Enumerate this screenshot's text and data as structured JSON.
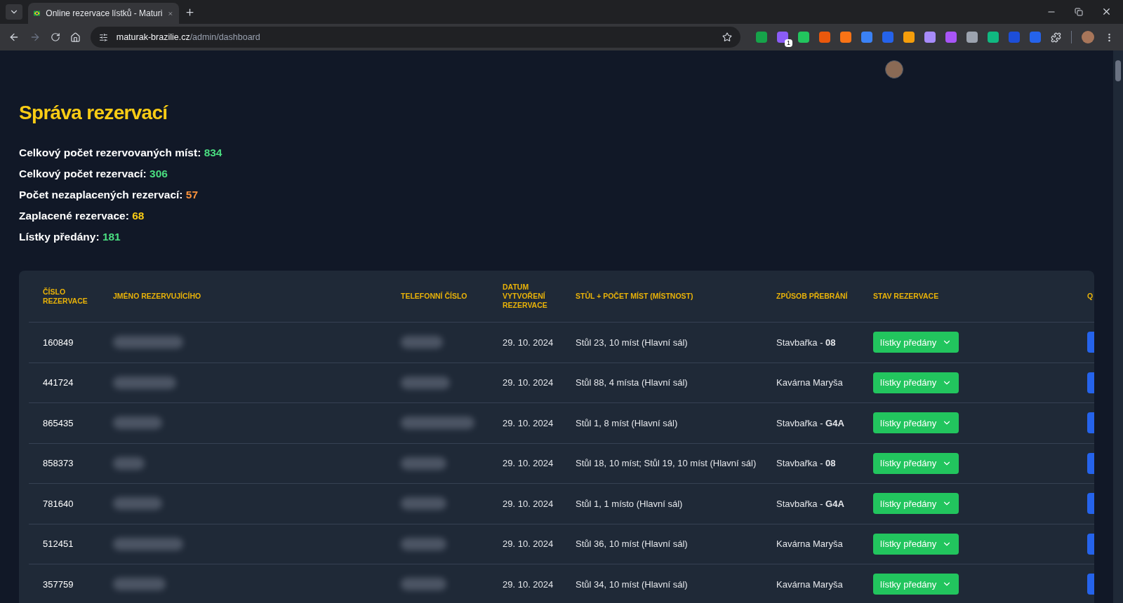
{
  "browser": {
    "tab_title": "Online rezervace lístků - Maturi",
    "url_host": "maturak-brazilie.cz",
    "url_path": "/admin/dashboard",
    "extension_badge": "1"
  },
  "page": {
    "title": "Správa rezervací",
    "stats": [
      {
        "label": "Celkový počet rezervovaných míst:",
        "value": "834",
        "color": "#4ade80"
      },
      {
        "label": "Celkový počet rezervací:",
        "value": "306",
        "color": "#4ade80"
      },
      {
        "label": "Počet nezaplacených rezervací:",
        "value": "57",
        "color": "#fb923c"
      },
      {
        "label": "Zaplacené rezervace:",
        "value": "68",
        "color": "#facc15"
      },
      {
        "label": "Lístky předány:",
        "value": "181",
        "color": "#4ade80"
      }
    ]
  },
  "table": {
    "columns": [
      "ČÍSLO REZERVACE",
      "JMÉNO REZERVUJÍCÍHO",
      "TELEFONNÍ ČÍSLO",
      "DATUM VYTVOŘENÍ REZERVACE",
      "STŮL + POČET MÍST (MÍSTNOST)",
      "ZPŮSOB PŘEBRÁNÍ",
      "STAV REZERVACE",
      "Q"
    ],
    "rows": [
      {
        "number": "160849",
        "date": "29. 10. 2024",
        "table": "Stůl 23, 10 míst (Hlavní sál)",
        "pickup": "Stavbařka - **08**",
        "status": "lístky předány"
      },
      {
        "number": "441724",
        "date": "29. 10. 2024",
        "table": "Stůl 88, 4 místa (Hlavní sál)",
        "pickup": "Kavárna Maryša",
        "status": "lístky předány"
      },
      {
        "number": "865435",
        "date": "29. 10. 2024",
        "table": "Stůl 1, 8 míst (Hlavní sál)",
        "pickup": "Stavbařka - **G4A**",
        "status": "lístky předány"
      },
      {
        "number": "858373",
        "date": "29. 10. 2024",
        "table": "Stůl 18, 10 míst; Stůl 19, 10 míst (Hlavní sál)",
        "pickup": "Stavbařka - **08**",
        "status": "lístky předány"
      },
      {
        "number": "781640",
        "date": "29. 10. 2024",
        "table": "Stůl 1, 1 místo (Hlavní sál)",
        "pickup": "Stavbařka - **G4A**",
        "status": "lístky předány"
      },
      {
        "number": "512451",
        "date": "29. 10. 2024",
        "table": "Stůl 36, 10 míst (Hlavní sál)",
        "pickup": "Kavárna Maryša",
        "status": "lístky předány"
      },
      {
        "number": "357759",
        "date": "29. 10. 2024",
        "table": "Stůl 34, 10 míst (Hlavní sál)",
        "pickup": "Kavárna Maryša",
        "status": "lístky předány"
      }
    ]
  }
}
